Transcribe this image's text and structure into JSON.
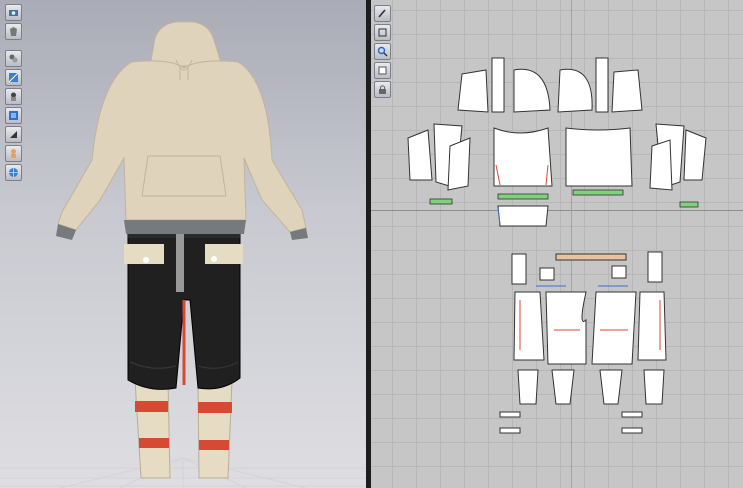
{
  "viewport3d": {
    "tools": [
      {
        "name": "snapshot-icon"
      },
      {
        "name": "avatar-display-icon"
      },
      {
        "name": "render-mode-icon"
      },
      {
        "name": "texture-mode-icon"
      },
      {
        "name": "stress-map-icon"
      },
      {
        "name": "fabric-solid-icon"
      },
      {
        "name": "shading-icon"
      },
      {
        "name": "avatar-skin-icon"
      },
      {
        "name": "sphere-view-icon"
      }
    ]
  },
  "viewport2d": {
    "tools": [
      {
        "name": "pattern-edit-icon"
      },
      {
        "name": "transform-pattern-icon"
      },
      {
        "name": "zoom-icon"
      },
      {
        "name": "layer-icon"
      },
      {
        "name": "lock-icon"
      }
    ]
  },
  "colors": {
    "hoodie": "#e0d3bc",
    "trousers": "#1f1f1f",
    "stripe": "#d64933",
    "cuff": "#777a7c",
    "legwear": "#e6dcc4",
    "pattern_fill": "#ffffff",
    "binding_green": "#7ed27a",
    "band_tan": "#e9c39f"
  }
}
